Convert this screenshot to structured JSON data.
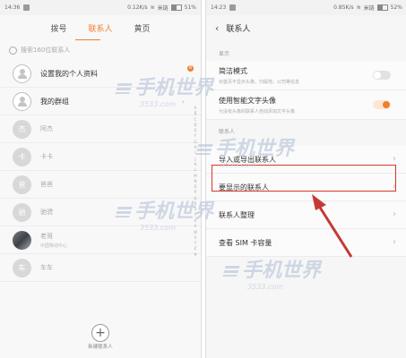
{
  "left": {
    "status": {
      "time": "14:36",
      "right": "0.12K/s",
      "carrier": "米链",
      "battery": "51%"
    },
    "tabs": [
      {
        "label": "拨号"
      },
      {
        "label": "联系人",
        "active": true
      },
      {
        "label": "黄页"
      }
    ],
    "search_placeholder": "搜索160位联系人",
    "rows": [
      {
        "label": "设置我的个人资料",
        "badge": "8"
      },
      {
        "label": "我的群组"
      },
      {
        "avatar": "杰",
        "label": "阿杰"
      },
      {
        "avatar": "卡",
        "label": "卡卡"
      },
      {
        "avatar": "爸",
        "label": "爸爸"
      },
      {
        "avatar": "驰",
        "label": "驰骋"
      },
      {
        "label": "老哥",
        "sub": "中国移动中心"
      },
      {
        "avatar": "车",
        "label": "车车"
      }
    ],
    "index_letters": [
      "A",
      "B",
      "C",
      "D",
      "E",
      "F",
      "G",
      "H",
      "I",
      "J",
      "K",
      "L",
      "M",
      "N",
      "O",
      "P",
      "Q",
      "R",
      "S",
      "T",
      "U",
      "V",
      "W",
      "X",
      "Y",
      "Z",
      "#"
    ],
    "add_label": "新建联系人"
  },
  "right": {
    "status": {
      "time": "14:23",
      "right": "0.85K/s",
      "carrier": "米链",
      "battery": "52%"
    },
    "title": "联系人",
    "section_display": "显示",
    "settings": [
      {
        "label": "简洁模式",
        "desc": "对首页不显示头像，归属地，公司等信息",
        "toggle": false
      },
      {
        "label": "使用智能文字头像",
        "desc": "为没有头像的联系人自动添加文字头像",
        "toggle": true
      }
    ],
    "section_contacts": "联系人",
    "items": [
      {
        "label": "导入或导出联系人"
      },
      {
        "label": "要显示的联系人"
      },
      {
        "label": "联系人整理"
      },
      {
        "label": "查看 SIM 卡容量"
      }
    ]
  },
  "watermark": {
    "text": "手机世界",
    "sub": "3533.com"
  },
  "colors": {
    "accent": "#ef7f2f",
    "highlight": "#d9352a",
    "arrow": "#c23b35"
  }
}
